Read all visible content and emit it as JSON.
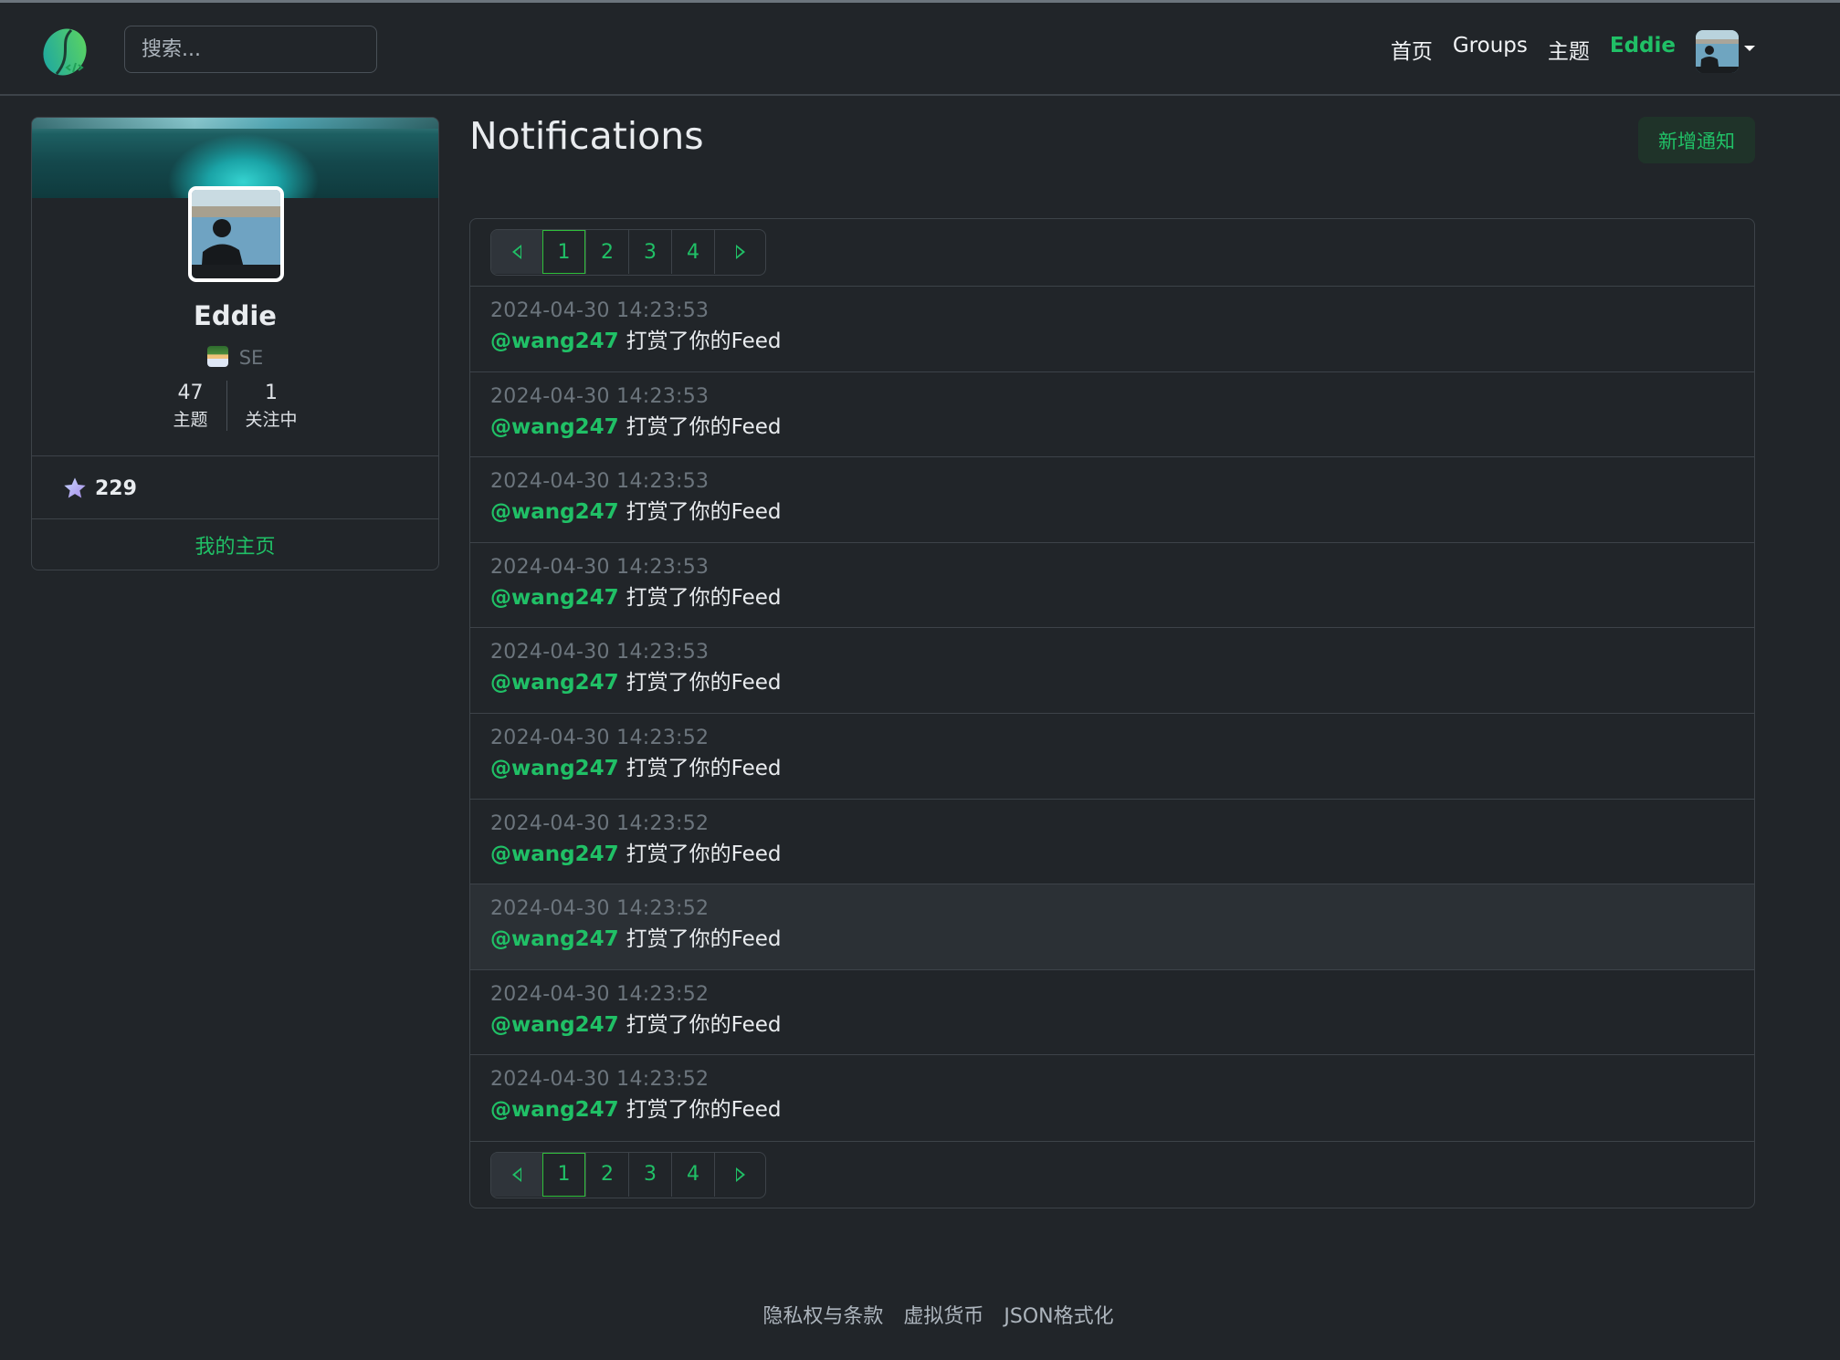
{
  "navbar": {
    "search_placeholder": "搜索...",
    "links": [
      {
        "label": "首页"
      },
      {
        "label": "Groups"
      },
      {
        "label": "主题"
      },
      {
        "label": "Eddie",
        "active": true
      }
    ],
    "avatar_icon": "user-avatar",
    "dropdown_icon": "caret-down-icon",
    "logo_icon": "bean-code-logo"
  },
  "profile": {
    "name": "Eddie",
    "role_emoji": "technologist-emoji",
    "role": "SE",
    "stats": [
      {
        "value": "47",
        "label": "主题"
      },
      {
        "value": "1",
        "label": "关注中"
      }
    ],
    "score_icon": "star-icon",
    "score": "229",
    "home_link": "我的主页"
  },
  "main": {
    "title": "Notifications",
    "add_button": "新增通知",
    "pagination": {
      "prev_icon": "prev-triangle-icon",
      "next_icon": "next-triangle-icon",
      "pages": [
        "1",
        "2",
        "3",
        "4"
      ],
      "current": "1"
    },
    "notifications": [
      {
        "time": "2024-04-30 14:23:53",
        "user": "@wang247",
        "text": "打赏了你的Feed"
      },
      {
        "time": "2024-04-30 14:23:53",
        "user": "@wang247",
        "text": "打赏了你的Feed"
      },
      {
        "time": "2024-04-30 14:23:53",
        "user": "@wang247",
        "text": "打赏了你的Feed"
      },
      {
        "time": "2024-04-30 14:23:53",
        "user": "@wang247",
        "text": "打赏了你的Feed"
      },
      {
        "time": "2024-04-30 14:23:53",
        "user": "@wang247",
        "text": "打赏了你的Feed"
      },
      {
        "time": "2024-04-30 14:23:52",
        "user": "@wang247",
        "text": "打赏了你的Feed"
      },
      {
        "time": "2024-04-30 14:23:52",
        "user": "@wang247",
        "text": "打赏了你的Feed"
      },
      {
        "time": "2024-04-30 14:23:52",
        "user": "@wang247",
        "text": "打赏了你的Feed",
        "hovered": true
      },
      {
        "time": "2024-04-30 14:23:52",
        "user": "@wang247",
        "text": "打赏了你的Feed"
      },
      {
        "time": "2024-04-30 14:23:52",
        "user": "@wang247",
        "text": "打赏了你的Feed"
      }
    ]
  },
  "footer": {
    "links": [
      "隐私权与条款",
      "虚拟货币",
      "JSON格式化"
    ]
  },
  "colors": {
    "accent": "#20c066",
    "background": "#212529",
    "border": "#3d4349",
    "muted": "#6c757d",
    "hover_row": "#2b3035"
  }
}
